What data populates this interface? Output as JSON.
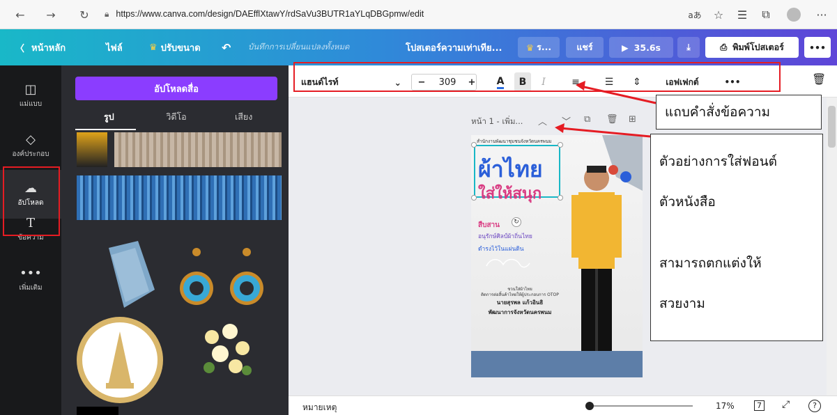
{
  "browser": {
    "url": "https://www.canva.com/design/DAEfflXtawY/rdSaVu3BUTR1aYLqDBGpmw/edit",
    "reader_label": "aあ"
  },
  "topbar": {
    "home_label": "หน้าหลัก",
    "file_label": "ไฟล์",
    "resize_label": "ปรับขนาด",
    "undo_hint": "บันทึกการเปลี่ยนแปลงทั้งหมด",
    "design_title": "โปสเตอร์ความเท่าเทีย...",
    "crown_label": "ร...",
    "share_label": "แชร์",
    "present_time": "35.6s",
    "print_label": "พิมพ์โปสเตอร์",
    "more_label": "•••"
  },
  "rail": {
    "items": [
      {
        "label": "แม่แบบ",
        "icon": "template-icon"
      },
      {
        "label": "องค์ประกอบ",
        "icon": "elements-icon"
      },
      {
        "label": "อัปโหลด",
        "icon": "upload-icon"
      },
      {
        "label": "ข้อความ",
        "icon": "text-icon"
      },
      {
        "label": "เพิ่มเติม",
        "icon": "more-icon"
      }
    ]
  },
  "panel": {
    "upload_button": "อัปโหลดสื่อ",
    "tabs": [
      "รูป",
      "วิดีโอ",
      "เสียง"
    ]
  },
  "textbar": {
    "font_name": "แฮนด์ไรท์",
    "font_size": "309",
    "effects_label": "เอฟเฟกต์",
    "more_label": "•••"
  },
  "page": {
    "label": "หน้า 1 - เพิ่ม..."
  },
  "poster": {
    "header": "สำนักงานพัฒนาชุมชนจังหวัดนครพนม",
    "title1": "ผ้าไทย",
    "title2": "ใส่ให้สนุก",
    "line1": "สืบสาน",
    "line2": "อนุรักษ์ศิลป์ผ้าถิ่นไทย",
    "line3": "ดำรงไว้ในแผ่นดิน",
    "small1": "ชวนใส่ผ้าไทย",
    "small2": "ติดการต่อสิ้นค้าไทยให้ผู้ประกอบการ OTOP",
    "name": "นายสุรพล แก้วอินธิ",
    "position": "พัฒนาการจังหวัดนครพนม"
  },
  "callouts": {
    "textbar_label": "แถบคำสั่งข้อความ",
    "lines": [
      "ตัวอย่างการใส่ฟอนต์",
      "ตัวหนังสือ",
      "",
      "สามารถตกแต่งให้",
      "สวยงาม"
    ]
  },
  "bottom": {
    "notes_label": "หมายเหตุ",
    "zoom": "17%",
    "page_count": "7"
  },
  "colors": {
    "canva_purple": "#8b3dff",
    "annotation_red": "#e51c23",
    "selection_cyan": "#18b7c6"
  }
}
